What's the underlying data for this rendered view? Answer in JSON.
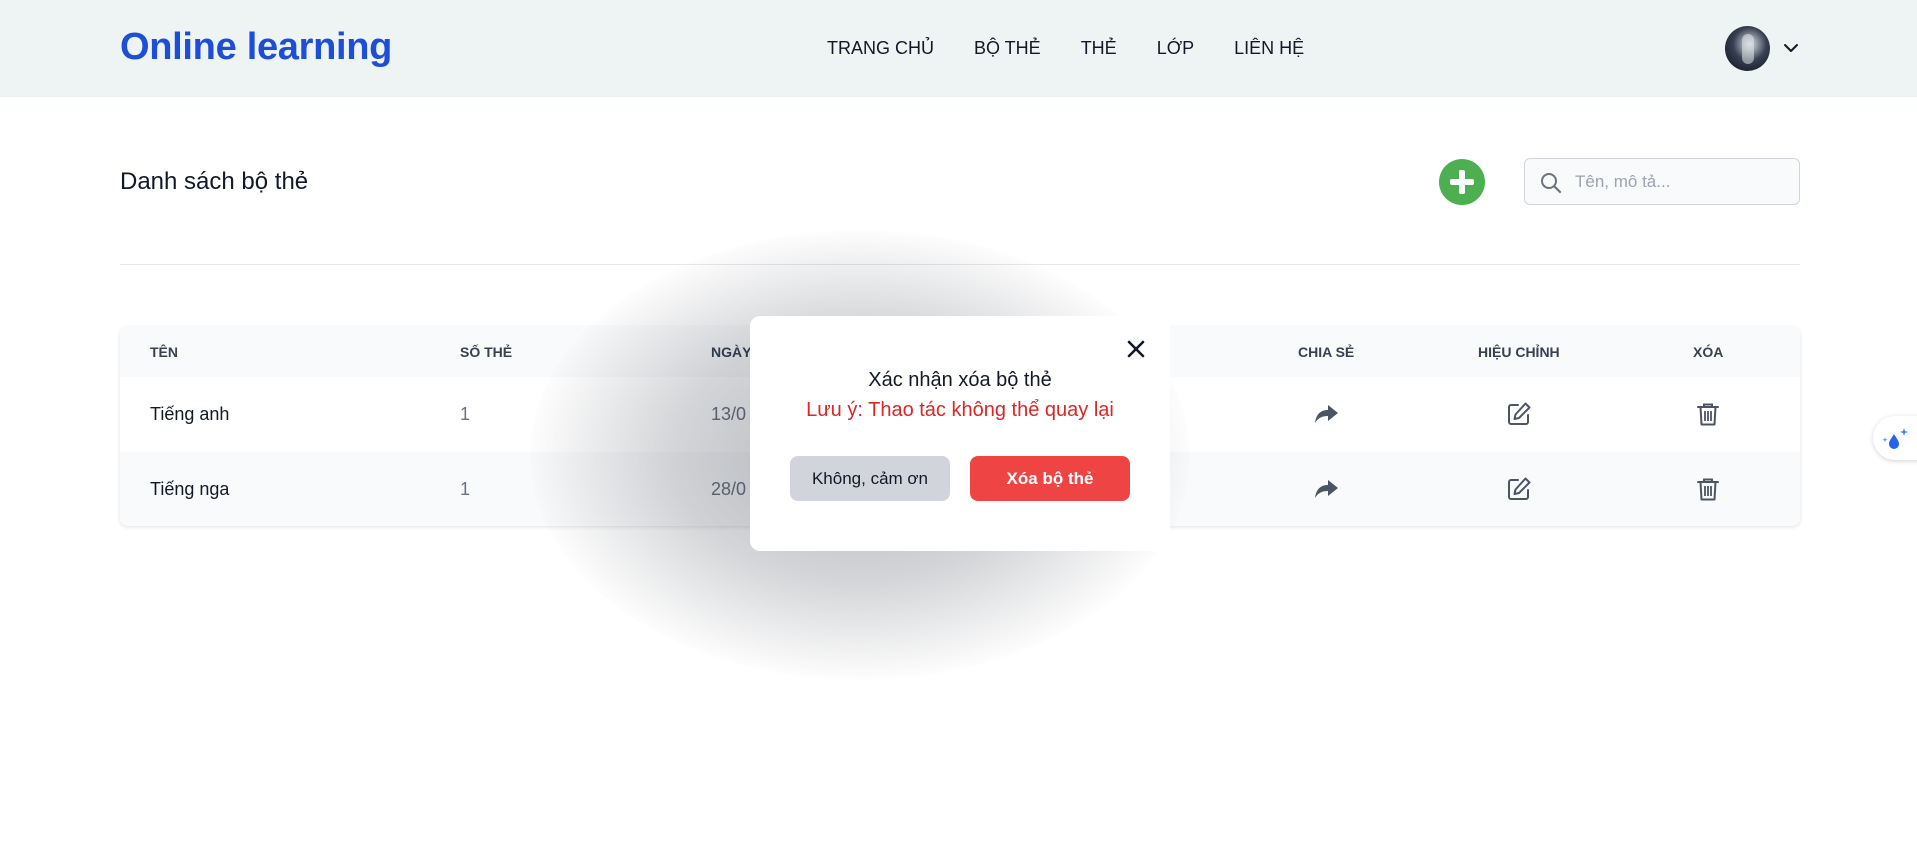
{
  "header": {
    "brand": "Online learning",
    "nav": [
      "TRANG CHỦ",
      "BỘ THẺ",
      "THẺ",
      "LỚP",
      "LIÊN HỆ"
    ]
  },
  "page": {
    "title": "Danh sách bộ thẻ",
    "search_placeholder": "Tên, mô tả..."
  },
  "table": {
    "columns": [
      "TÊN",
      "SỐ THẺ",
      "NGÀY",
      "CHIA SẺ",
      "HIỆU CHỈNH",
      "XÓA"
    ],
    "rows": [
      {
        "name": "Tiếng anh",
        "count": "1",
        "date": "13/0"
      },
      {
        "name": "Tiếng nga",
        "count": "1",
        "date": "28/0"
      }
    ]
  },
  "modal": {
    "title": "Xác nhận xóa bộ thẻ",
    "warning": "Lưu ý: Thao tác không thể quay lại",
    "cancel_label": "Không, cảm ơn",
    "confirm_label": "Xóa bộ thẻ"
  },
  "colors": {
    "brand": "#1d4ed8",
    "add": "#4caf50",
    "danger": "#ef4444",
    "header_bg": "#eef4f4"
  },
  "icons": {
    "add": "plus-circle-icon",
    "search": "search-icon",
    "share": "share-arrow-icon",
    "edit": "edit-icon",
    "delete": "trash-icon",
    "close": "close-icon",
    "chevron": "chevron-down-icon"
  }
}
